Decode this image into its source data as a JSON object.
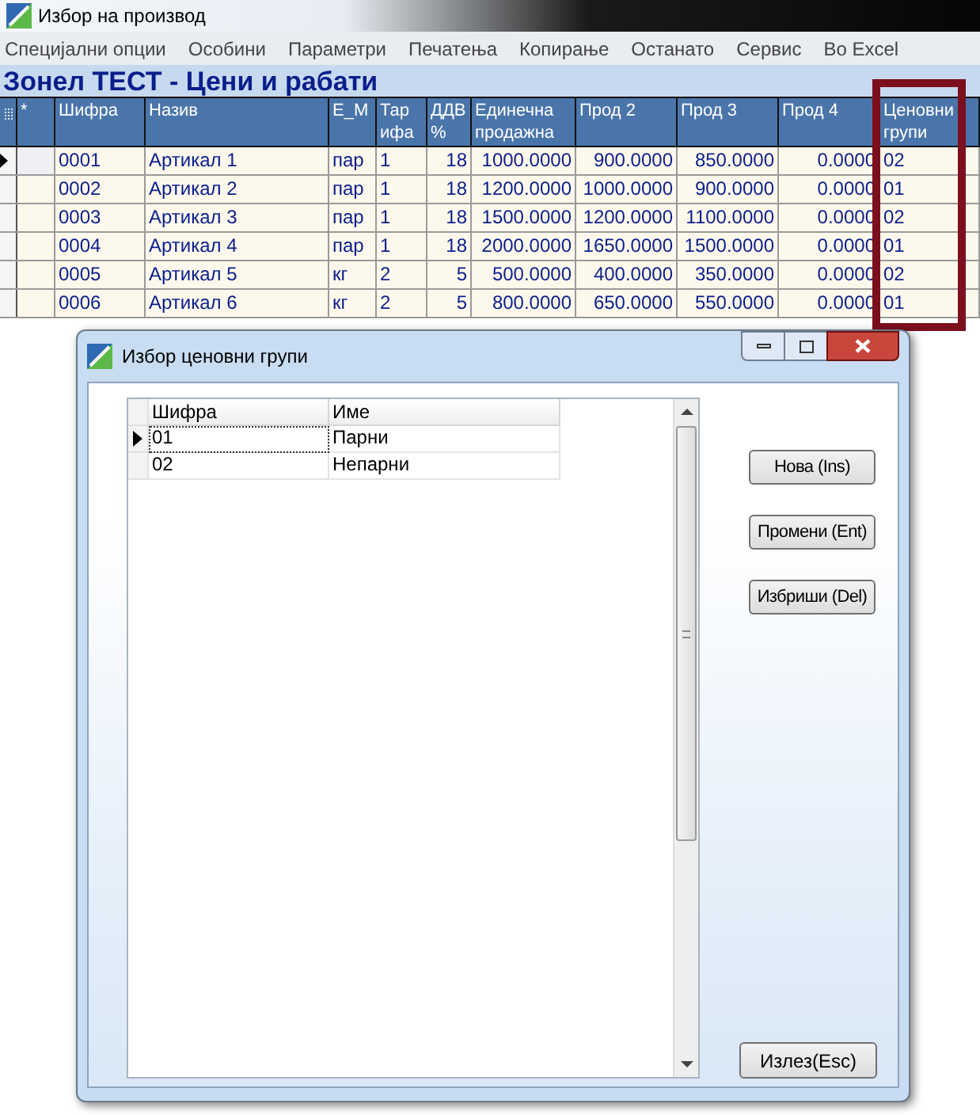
{
  "window": {
    "title": "Избор на производ"
  },
  "menu": [
    "Специјални опции",
    "Особини",
    "Параметри",
    "Печатења",
    "Копирање",
    "Останато",
    "Сервис",
    "Во Excel"
  ],
  "heading": "Зонел ТЕСТ - Цени и рабати",
  "table": {
    "marker_column": "*",
    "columns": [
      "Шифра",
      "Назив",
      "Е_М",
      "Тар ифа",
      "ДДВ %",
      "Единечна продажна",
      "Прод 2",
      "Прод 3",
      "Прод 4",
      "Ценовни групи"
    ],
    "rows": [
      {
        "selected": true,
        "cells": [
          "0001",
          "Артикал 1",
          "пар",
          "1",
          "18",
          "1000.0000",
          "900.0000",
          "850.0000",
          "0.0000",
          "02"
        ]
      },
      {
        "selected": false,
        "cells": [
          "0002",
          "Артикал 2",
          "пар",
          "1",
          "18",
          "1200.0000",
          "1000.0000",
          "900.0000",
          "0.0000",
          "01"
        ]
      },
      {
        "selected": false,
        "cells": [
          "0003",
          "Артикал 3",
          "пар",
          "1",
          "18",
          "1500.0000",
          "1200.0000",
          "1100.0000",
          "0.0000",
          "02"
        ]
      },
      {
        "selected": false,
        "cells": [
          "0004",
          "Артикал 4",
          "пар",
          "1",
          "18",
          "2000.0000",
          "1650.0000",
          "1500.0000",
          "0.0000",
          "01"
        ]
      },
      {
        "selected": false,
        "cells": [
          "0005",
          "Артикал 5",
          "кг",
          "2",
          "5",
          "500.0000",
          "400.0000",
          "350.0000",
          "0.0000",
          "02"
        ]
      },
      {
        "selected": false,
        "cells": [
          "0006",
          "Артикал 6",
          "кг",
          "2",
          "5",
          "800.0000",
          "650.0000",
          "550.0000",
          "0.0000",
          "01"
        ]
      }
    ]
  },
  "dialog": {
    "title": "Избор ценовни групи",
    "table": {
      "columns": [
        "Шифра",
        "Име"
      ],
      "rows": [
        {
          "selected": true,
          "cells": [
            "01",
            "Парни"
          ]
        },
        {
          "selected": false,
          "cells": [
            "02",
            "Непарни"
          ]
        }
      ]
    },
    "buttons": [
      "Нова (Ins)",
      "Промени (Ent)",
      "Избриши (Del)"
    ],
    "exit_button": "Излез(Esc)"
  }
}
